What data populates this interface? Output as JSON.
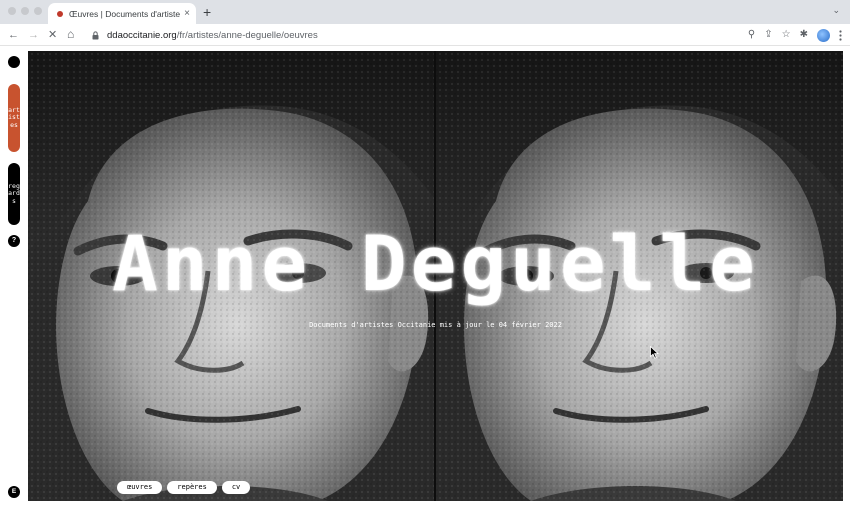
{
  "browser": {
    "tab": {
      "title": "Œuvres | Documents d'artistes Occitanie",
      "close": "×"
    },
    "new_tab": "+",
    "tab_menu": "⌄",
    "nav": {
      "back": "←",
      "forward": "→",
      "reload": "✕",
      "home": "⌂"
    },
    "url": {
      "domain": "ddaoccitanie.org",
      "path": "/fr/artistes/anne-deguelle/oeuvres"
    },
    "tools": {
      "zoom": "⚲",
      "share": "⇪",
      "bookmark": "☆",
      "extensions": "✱"
    }
  },
  "sidebar": {
    "artistes": {
      "label": "artistes",
      "color": "#c8532f"
    },
    "regards": {
      "label": "regards",
      "color": "#000000"
    },
    "help": "?",
    "lang": "E"
  },
  "hero": {
    "title": "Anne Deguelle",
    "caption": "Documents d'artistes Occitanie mis à jour le 04 février 2022"
  },
  "tabs": [
    {
      "label": "œuvres"
    },
    {
      "label": "repères"
    },
    {
      "label": "cv"
    }
  ]
}
